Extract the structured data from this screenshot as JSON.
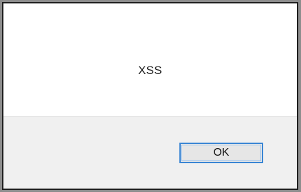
{
  "dialog": {
    "message": "XSS",
    "ok_label": "OK"
  },
  "colors": {
    "frame": "#8d8d8d",
    "border": "#1e1e1e",
    "content_bg": "#ffffff",
    "button_bar_bg": "#f0f0f0",
    "button_focus": "#3a86d4"
  }
}
